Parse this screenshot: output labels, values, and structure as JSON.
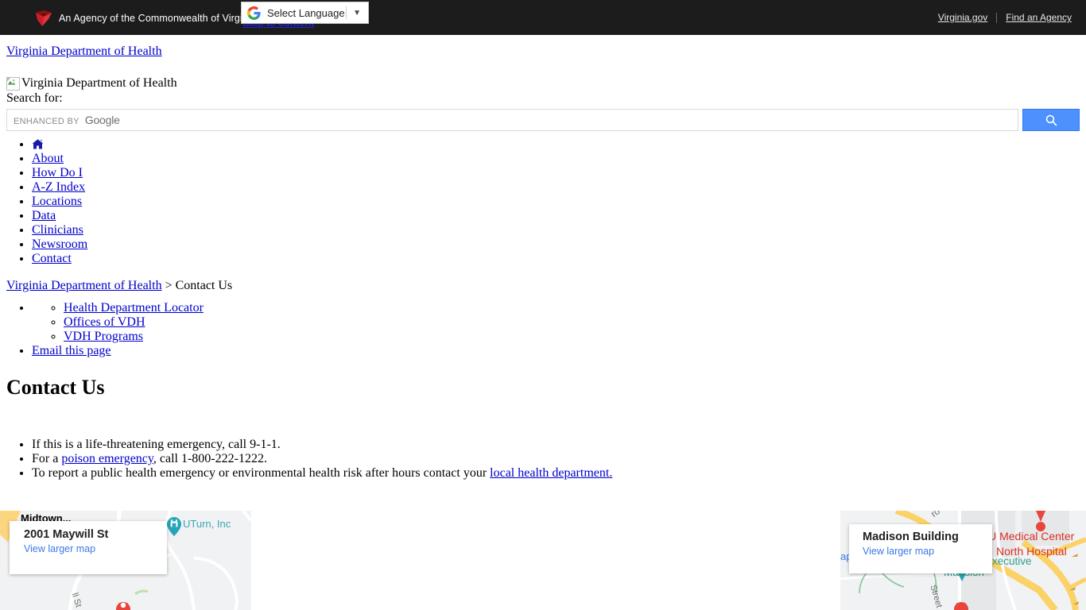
{
  "gov_banner": {
    "logo_icon": "virginia-flying-v-icon",
    "agency_text": "An Agency of the Commonwealth of Virginia",
    "links": [
      {
        "label": "Virginia.gov"
      },
      {
        "label": "Find an Agency"
      }
    ],
    "skip_link": "Skip to content"
  },
  "translate_widget": {
    "icon": "google-g-icon",
    "label": "Select Language",
    "caret_icon": "chevron-down-icon"
  },
  "site": {
    "title_link": "Virginia Department of Health",
    "logo_alt": "Virginia Department of Health",
    "logo_icon": "broken-image-icon"
  },
  "search": {
    "label": "Search for:",
    "watermark_prefix": "ENHANCED BY",
    "watermark_brand": "Google",
    "placeholder": "",
    "value": "",
    "button_icon": "search-icon",
    "button_color": "#4d90fe"
  },
  "main_nav": {
    "home_icon": "home-icon",
    "items": [
      {
        "label": "About"
      },
      {
        "label": "How Do I"
      },
      {
        "label": "A-Z Index"
      },
      {
        "label": "Locations"
      },
      {
        "label": "Data"
      },
      {
        "label": "Clinicians"
      },
      {
        "label": "Newsroom"
      },
      {
        "label": "Contact"
      }
    ]
  },
  "breadcrumb": {
    "root": "Virginia Department of Health",
    "separator": ">",
    "current": "Contact Us"
  },
  "sub_nav": {
    "items": [
      {
        "label": "Health Department Locator"
      },
      {
        "label": "Offices of VDH"
      },
      {
        "label": "VDH Programs"
      }
    ],
    "email_link": "Email this page"
  },
  "page": {
    "title": "Contact Us",
    "emergency_items": [
      {
        "pre": "If this is a life-threatening emergency, call 9-1-1.",
        "link": "",
        "post": ""
      },
      {
        "pre": "For a ",
        "link": "poison emergency",
        "post": ", call 1-800-222-1222."
      },
      {
        "pre": "To report a public health emergency or environmental health risk after hours contact your ",
        "link": "local health department.",
        "post": ""
      }
    ]
  },
  "maps": {
    "left": {
      "card_title": "2001 Maywill St",
      "card_link": "View larger map",
      "labels": [
        {
          "text": "Midtown...",
          "color": "#e8567d"
        },
        {
          "text": "UTurn, Inc",
          "color": "#3aa8b6"
        },
        {
          "text": "ll St",
          "color": "#6b6b6b"
        }
      ],
      "marker_icon": "map-marker-icon",
      "poi_icon": "uturn-poi-icon"
    },
    "right": {
      "card_title": "Madison Building",
      "card_link": "View larger map",
      "labels": [
        {
          "text": "CU Medical Center",
          "color": "#d93025"
        },
        {
          "text": "North Hospital",
          "color": "#d93025"
        },
        {
          "text": "Executive",
          "color": "#2e9e8f"
        },
        {
          "text": "Mansion",
          "color": "#2e9e8f"
        },
        {
          "text": "Street",
          "color": "#6b6b6b"
        },
        {
          "text": "ap",
          "color": "#3b78e7"
        },
        {
          "text": "ro",
          "color": "#6b6b6b"
        }
      ],
      "marker_icon": "map-marker-icon",
      "highway_color": "#fbd267"
    }
  }
}
